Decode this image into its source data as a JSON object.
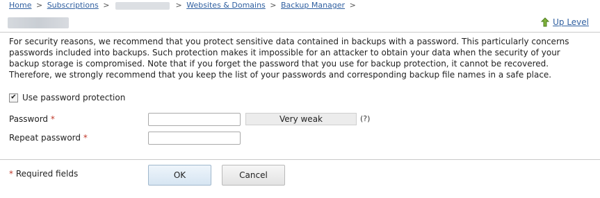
{
  "breadcrumb": {
    "home": "Home",
    "subscriptions": "Subscriptions",
    "websites_domains": "Websites & Domains",
    "backup_manager": "Backup Manager",
    "separator": ">"
  },
  "header": {
    "up_level": "Up Level"
  },
  "info_text": "For security reasons, we recommend that you protect sensitive data contained in backups with a password. This particularly concerns passwords included into backups. Such protection makes it impossible for an attacker to obtain your data when the security of your backup storage is compromised. Note that if you forget the password that you use for backup protection, it cannot be recovered. Therefore, we strongly recommend that you keep the list of your passwords and corresponding backup file names in a safe place.",
  "form": {
    "use_password_label": "Use password protection",
    "use_password_checked": true,
    "password_label": "Password",
    "repeat_password_label": "Repeat password",
    "required_mark": "*",
    "strength_text": "Very weak",
    "help_text": "(?)",
    "required_fields_text": "Required fields"
  },
  "buttons": {
    "ok": "OK",
    "cancel": "Cancel"
  }
}
